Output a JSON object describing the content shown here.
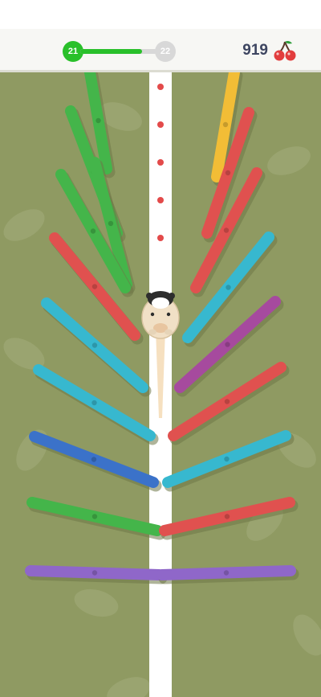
{
  "hud": {
    "level_current": "21",
    "level_next": "22",
    "level_progress": 0.8,
    "score": "919",
    "currency_icon": "cherry-icon"
  },
  "colors": {
    "field": "#8f9a62",
    "path": "#ffffff",
    "dot": "#e34a4a",
    "green": "#44b54a",
    "yellow": "#f2bd36",
    "red": "#e0514f",
    "cyan": "#37b8cf",
    "purple": "#a64a9e",
    "blue": "#3b72c9",
    "violet": "#8f67c9",
    "progress": "#29c02a"
  },
  "character": {
    "name": "cow-icon"
  },
  "sticks": [
    {
      "color": "green"
    },
    {
      "color": "green"
    },
    {
      "color": "green"
    },
    {
      "color": "green"
    },
    {
      "color": "red"
    },
    {
      "color": "cyan"
    },
    {
      "color": "cyan"
    },
    {
      "color": "blue"
    },
    {
      "color": "green"
    },
    {
      "color": "yellow"
    },
    {
      "color": "red"
    },
    {
      "color": "red"
    },
    {
      "color": "cyan"
    },
    {
      "color": "purple"
    },
    {
      "color": "red"
    },
    {
      "color": "cyan"
    },
    {
      "color": "red"
    },
    {
      "color": "violet"
    },
    {
      "color": "violet"
    }
  ]
}
